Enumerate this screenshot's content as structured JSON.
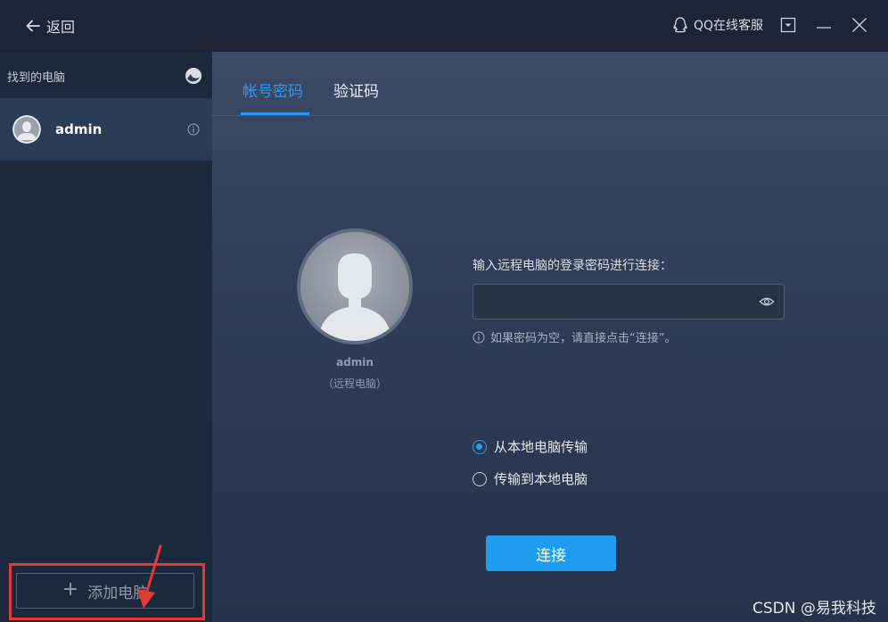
{
  "titlebar": {
    "back_label": "返回",
    "support_label": "QQ在线客服"
  },
  "sidebar": {
    "found_label": "找到的电脑",
    "computers": [
      {
        "name": "admin"
      }
    ],
    "add_button_label": "添加电脑"
  },
  "main": {
    "tabs": [
      {
        "label": "帐号密码",
        "active": true
      },
      {
        "label": "验证码",
        "active": false
      }
    ],
    "remote": {
      "name": "admin",
      "subtitle": "（远程电脑）"
    },
    "password": {
      "prompt": "输入远程电脑的登录密码进行连接：",
      "value": "",
      "hint": "如果密码为空，请直接点击“连接”。"
    },
    "direction_options": [
      {
        "label": "从本地电脑传输",
        "checked": true
      },
      {
        "label": "传输到本地电脑",
        "checked": false
      }
    ],
    "connect_label": "连接"
  },
  "watermark": "CSDN @易我科技",
  "colors": {
    "accent": "#2a9af3",
    "annotation": "#e53935",
    "sidebar_bg": "#1c283b",
    "selected_item_bg": "#2a3b55"
  },
  "icons": [
    "back-arrow-icon",
    "qq-icon",
    "dropdown-menu-icon",
    "minimize-icon",
    "close-icon",
    "refresh-icon",
    "avatar-icon",
    "info-icon",
    "eye-icon",
    "plus-icon"
  ]
}
